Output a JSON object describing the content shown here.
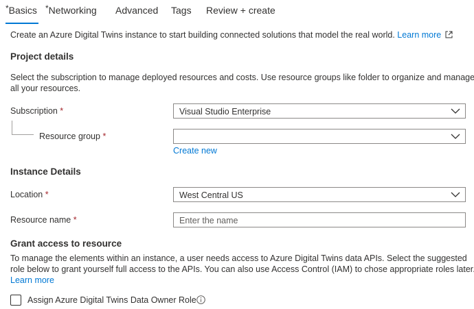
{
  "tabs": [
    {
      "label": "Basics",
      "required": true,
      "active": true
    },
    {
      "label": "Networking",
      "required": true,
      "active": false
    },
    {
      "label": "Advanced",
      "required": false,
      "active": false
    },
    {
      "label": "Tags",
      "required": false,
      "active": false
    },
    {
      "label": "Review + create",
      "required": false,
      "active": false
    }
  ],
  "intro": {
    "text": "Create an Azure Digital Twins instance to start building connected solutions that model the real world.",
    "learn_more": "Learn more"
  },
  "project_details": {
    "heading": "Project details",
    "description_line1": "Select the subscription to manage deployed resources and costs. Use resource groups like folder to organize and manage",
    "description_line2": "all your resources.",
    "subscription": {
      "label": "Subscription",
      "value": "Visual Studio Enterprise"
    },
    "resource_group": {
      "label": "Resource group",
      "value": "",
      "create_new": "Create new"
    }
  },
  "instance_details": {
    "heading": "Instance Details",
    "location": {
      "label": "Location",
      "value": "West Central US"
    },
    "resource_name": {
      "label": "Resource name",
      "placeholder": "Enter the name"
    }
  },
  "grant_access": {
    "heading": "Grant access to resource",
    "line1": "To manage the elements within an instance, a user needs access to Azure Digital Twins data APIs. Select the suggested",
    "line2": "role below to grant yourself full access to the APIs. You can also use Access Control (IAM) to chose appropriate roles later.",
    "learn_more": "Learn more",
    "checkbox_label": "Assign Azure Digital Twins Data Owner Role",
    "checked": false
  },
  "required_marker": "*",
  "colors": {
    "accent": "#0078d4",
    "required": "#a4262c",
    "border": "#8a8886"
  }
}
